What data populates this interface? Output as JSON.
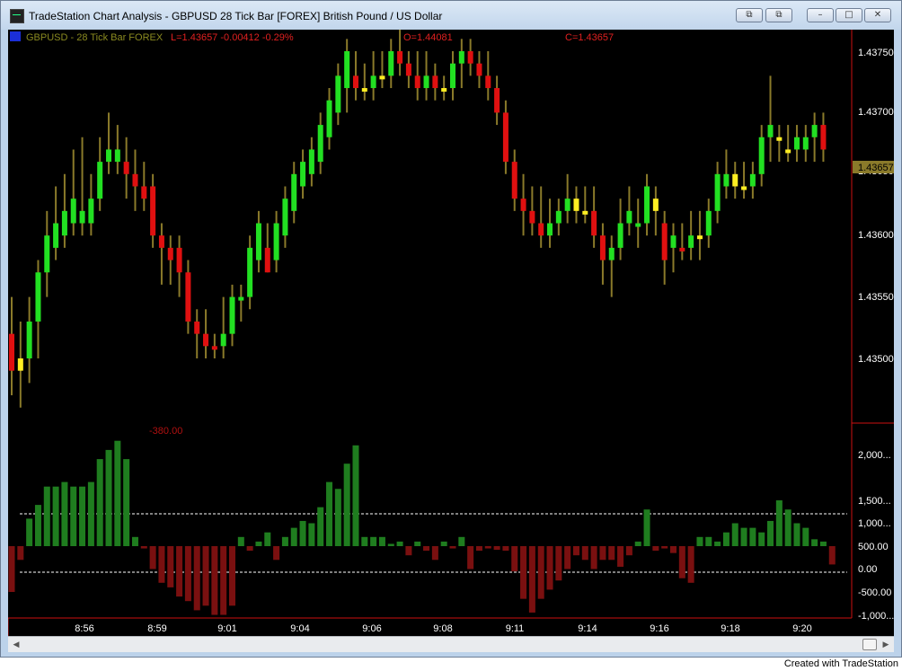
{
  "window": {
    "title": "TradeStation Chart Analysis - GBPUSD 28 Tick Bar [FOREX] British Pound / US Dollar",
    "buttons": {
      "minimize": "–",
      "maximize": "□",
      "close": "✕",
      "restore_left": "⧉",
      "restore_right": "⧉"
    }
  },
  "chart_header": {
    "symbol_text": "GBPUSD - 28 Tick Bar  FOREX",
    "last_text": "L=1.43657  -0.00412  -0.29%",
    "open_text": "O=1.44081",
    "close_text": "C=1.43657"
  },
  "indicator_label": "-380.00",
  "price_axis_labels": [
    "1.43750",
    "1.43700",
    "1.43650",
    "1.43600",
    "1.43550",
    "1.43500"
  ],
  "price_marker": "1.43657",
  "indicator_axis_labels": [
    "2,000...",
    "1,500...",
    "1,000...",
    "500.00",
    "0.00",
    "-500.00",
    "-1,000..."
  ],
  "time_labels": [
    "8:56",
    "8:59",
    "9:01",
    "9:04",
    "9:06",
    "9:08",
    "9:11",
    "9:14",
    "9:16",
    "9:18",
    "9:20"
  ],
  "colors": {
    "up": "#22e022",
    "down": "#e01010",
    "neutral": "#ffee22",
    "wick": "#8a7a2a",
    "hist_up": "#1f7d1f",
    "hist_down": "#7a1010",
    "axis": "#cc1111"
  },
  "footer_text": "Created with TradeStation",
  "chart_data": [
    {
      "type": "candlestick",
      "title": "GBPUSD - 28 Tick Bar FOREX",
      "ylim": [
        1.4346,
        1.4378
      ],
      "yticks": [
        1.4375,
        1.437,
        1.4365,
        1.436,
        1.4355,
        1.435
      ],
      "x_labels": [
        "8:56",
        "8:59",
        "9:01",
        "9:04",
        "9:06",
        "9:08",
        "9:11",
        "9:14",
        "9:16",
        "9:18",
        "9:20"
      ],
      "bars": [
        [
          1.4349,
          1.4352,
          1.4347,
          1.4355,
          "d"
        ],
        [
          1.4349,
          1.435,
          1.4346,
          1.4353,
          "n"
        ],
        [
          1.435,
          1.4353,
          1.4348,
          1.4355,
          "u"
        ],
        [
          1.4353,
          1.4357,
          1.435,
          1.4358,
          "u"
        ],
        [
          1.4357,
          1.436,
          1.4355,
          1.4362,
          "u"
        ],
        [
          1.4359,
          1.4361,
          1.4358,
          1.4364,
          "u"
        ],
        [
          1.436,
          1.4362,
          1.4359,
          1.4365,
          "u"
        ],
        [
          1.4361,
          1.4363,
          1.436,
          1.4367,
          "u"
        ],
        [
          1.4362,
          1.4361,
          1.436,
          1.4368,
          "u"
        ],
        [
          1.4361,
          1.4363,
          1.436,
          1.4365,
          "u"
        ],
        [
          1.4363,
          1.4366,
          1.4362,
          1.4368,
          "u"
        ],
        [
          1.4366,
          1.4367,
          1.4365,
          1.437,
          "u"
        ],
        [
          1.4366,
          1.4367,
          1.4365,
          1.4369,
          "u"
        ],
        [
          1.4366,
          1.4365,
          1.4363,
          1.4368,
          "d"
        ],
        [
          1.4365,
          1.4364,
          1.4362,
          1.4367,
          "d"
        ],
        [
          1.4364,
          1.4363,
          1.4362,
          1.4366,
          "d"
        ],
        [
          1.4364,
          1.436,
          1.4359,
          1.4365,
          "d"
        ],
        [
          1.436,
          1.4359,
          1.4356,
          1.4361,
          "d"
        ],
        [
          1.4359,
          1.4358,
          1.4356,
          1.436,
          "d"
        ],
        [
          1.4359,
          1.4357,
          1.4355,
          1.436,
          "d"
        ],
        [
          1.4357,
          1.4353,
          1.4352,
          1.4358,
          "d"
        ],
        [
          1.4353,
          1.4352,
          1.435,
          1.4354,
          "d"
        ],
        [
          1.4352,
          1.4351,
          1.435,
          1.4354,
          "d"
        ],
        [
          1.4351,
          1.4351,
          1.435,
          1.4352,
          "d"
        ],
        [
          1.4351,
          1.4352,
          1.435,
          1.4355,
          "u"
        ],
        [
          1.4352,
          1.4355,
          1.4351,
          1.4356,
          "u"
        ],
        [
          1.4355,
          1.4355,
          1.4353,
          1.4356,
          "u"
        ],
        [
          1.4355,
          1.4359,
          1.4354,
          1.436,
          "u"
        ],
        [
          1.4358,
          1.4361,
          1.4357,
          1.4362,
          "u"
        ],
        [
          1.4359,
          1.4357,
          1.4357,
          1.4361,
          "d"
        ],
        [
          1.4358,
          1.4361,
          1.4357,
          1.4362,
          "u"
        ],
        [
          1.436,
          1.4363,
          1.4359,
          1.4364,
          "u"
        ],
        [
          1.4362,
          1.4365,
          1.4361,
          1.4366,
          "u"
        ],
        [
          1.4364,
          1.4366,
          1.4363,
          1.4367,
          "u"
        ],
        [
          1.4365,
          1.4367,
          1.4364,
          1.4368,
          "u"
        ],
        [
          1.4366,
          1.4369,
          1.4365,
          1.437,
          "u"
        ],
        [
          1.4368,
          1.4371,
          1.4367,
          1.4372,
          "u"
        ],
        [
          1.437,
          1.4373,
          1.4369,
          1.4374,
          "u"
        ],
        [
          1.4372,
          1.4375,
          1.437,
          1.4376,
          "u"
        ],
        [
          1.4373,
          1.4372,
          1.4371,
          1.4375,
          "d"
        ],
        [
          1.4372,
          1.4372,
          1.4371,
          1.4374,
          "n"
        ],
        [
          1.4372,
          1.4373,
          1.4371,
          1.4375,
          "u"
        ],
        [
          1.4373,
          1.4373,
          1.4372,
          1.4375,
          "n"
        ],
        [
          1.4373,
          1.4375,
          1.4372,
          1.4376,
          "u"
        ],
        [
          1.4375,
          1.4374,
          1.4373,
          1.4377,
          "d"
        ],
        [
          1.4374,
          1.4373,
          1.4372,
          1.4375,
          "d"
        ],
        [
          1.4373,
          1.4372,
          1.4371,
          1.4375,
          "d"
        ],
        [
          1.4372,
          1.4373,
          1.4371,
          1.4375,
          "u"
        ],
        [
          1.4373,
          1.4372,
          1.4371,
          1.4374,
          "d"
        ],
        [
          1.4372,
          1.4372,
          1.4371,
          1.4373,
          "n"
        ],
        [
          1.4372,
          1.4374,
          1.4371,
          1.4375,
          "u"
        ],
        [
          1.4374,
          1.4375,
          1.4372,
          1.4376,
          "u"
        ],
        [
          1.4375,
          1.4374,
          1.4373,
          1.4376,
          "d"
        ],
        [
          1.4374,
          1.4373,
          1.4372,
          1.4375,
          "d"
        ],
        [
          1.4373,
          1.4372,
          1.4371,
          1.4375,
          "d"
        ],
        [
          1.4372,
          1.437,
          1.4369,
          1.4373,
          "d"
        ],
        [
          1.437,
          1.4366,
          1.4365,
          1.4371,
          "d"
        ],
        [
          1.4366,
          1.4363,
          1.4362,
          1.4367,
          "d"
        ],
        [
          1.4363,
          1.4362,
          1.436,
          1.4365,
          "d"
        ],
        [
          1.4362,
          1.4361,
          1.436,
          1.4364,
          "d"
        ],
        [
          1.4361,
          1.436,
          1.4359,
          1.4364,
          "d"
        ],
        [
          1.436,
          1.4361,
          1.4359,
          1.4363,
          "u"
        ],
        [
          1.4361,
          1.4362,
          1.436,
          1.4363,
          "u"
        ],
        [
          1.4362,
          1.4363,
          1.4361,
          1.4365,
          "u"
        ],
        [
          1.4363,
          1.4362,
          1.4361,
          1.4364,
          "n"
        ],
        [
          1.4362,
          1.4362,
          1.4361,
          1.4364,
          "n"
        ],
        [
          1.4362,
          1.436,
          1.4359,
          1.4364,
          "d"
        ],
        [
          1.436,
          1.4358,
          1.4356,
          1.4361,
          "d"
        ],
        [
          1.4358,
          1.4359,
          1.4355,
          1.436,
          "u"
        ],
        [
          1.4359,
          1.4361,
          1.4358,
          1.4363,
          "u"
        ],
        [
          1.4361,
          1.4362,
          1.436,
          1.4364,
          "u"
        ],
        [
          1.4361,
          1.4361,
          1.4359,
          1.4363,
          "u"
        ],
        [
          1.4361,
          1.4364,
          1.436,
          1.4365,
          "u"
        ],
        [
          1.4363,
          1.4362,
          1.436,
          1.4364,
          "n"
        ],
        [
          1.4361,
          1.4358,
          1.4356,
          1.4362,
          "d"
        ],
        [
          1.4359,
          1.436,
          1.4357,
          1.4361,
          "u"
        ],
        [
          1.4359,
          1.4359,
          1.4358,
          1.4361,
          "d"
        ],
        [
          1.4359,
          1.436,
          1.4358,
          1.4362,
          "u"
        ],
        [
          1.436,
          1.436,
          1.4358,
          1.4362,
          "n"
        ],
        [
          1.436,
          1.4362,
          1.4359,
          1.4363,
          "u"
        ],
        [
          1.4362,
          1.4365,
          1.4361,
          1.4366,
          "u"
        ],
        [
          1.4364,
          1.4365,
          1.4363,
          1.4367,
          "u"
        ],
        [
          1.4364,
          1.4365,
          1.4363,
          1.4366,
          "n"
        ],
        [
          1.4364,
          1.4364,
          1.4363,
          1.4366,
          "n"
        ],
        [
          1.4364,
          1.4365,
          1.4363,
          1.4366,
          "u"
        ],
        [
          1.4365,
          1.4368,
          1.4364,
          1.4369,
          "u"
        ],
        [
          1.4368,
          1.4369,
          1.4366,
          1.4373,
          "u"
        ],
        [
          1.4368,
          1.4368,
          1.4366,
          1.4369,
          "n"
        ],
        [
          1.4367,
          1.4367,
          1.4366,
          1.4369,
          "n"
        ],
        [
          1.4367,
          1.4368,
          1.4366,
          1.4369,
          "u"
        ],
        [
          1.4367,
          1.4368,
          1.4366,
          1.4369,
          "u"
        ],
        [
          1.4368,
          1.4369,
          1.4366,
          1.437,
          "u"
        ],
        [
          1.4369,
          1.4367,
          1.4366,
          1.437,
          "d"
        ]
      ]
    },
    {
      "type": "bar",
      "title": "-380.00",
      "ylim": [
        -1500,
        2400
      ],
      "yticks": [
        2000,
        1500,
        1000,
        500,
        0,
        -500,
        -1000
      ],
      "reference_lines": [
        750,
        -580
      ],
      "values": [
        -1000,
        -300,
        600,
        900,
        1300,
        1300,
        1400,
        1300,
        1300,
        1400,
        1900,
        2100,
        2300,
        1900,
        200,
        -50,
        -500,
        -800,
        -900,
        -1100,
        -1200,
        -1400,
        -1300,
        -1500,
        -1500,
        -1300,
        200,
        -100,
        100,
        300,
        -300,
        200,
        400,
        550,
        500,
        850,
        1400,
        1250,
        1800,
        2200,
        200,
        200,
        200,
        50,
        100,
        -200,
        100,
        -100,
        -300,
        100,
        -50,
        200,
        -500,
        -100,
        -50,
        -80,
        -100,
        -550,
        -1150,
        -1450,
        -1150,
        -950,
        -750,
        -500,
        -200,
        -300,
        -500,
        -300,
        -300,
        -450,
        -200,
        100,
        800,
        -100,
        -50,
        -150,
        -700,
        -800,
        200,
        200,
        100,
        300,
        500,
        400,
        400,
        300,
        550,
        1000,
        800,
        500,
        400,
        150,
        100,
        -400
      ]
    }
  ]
}
